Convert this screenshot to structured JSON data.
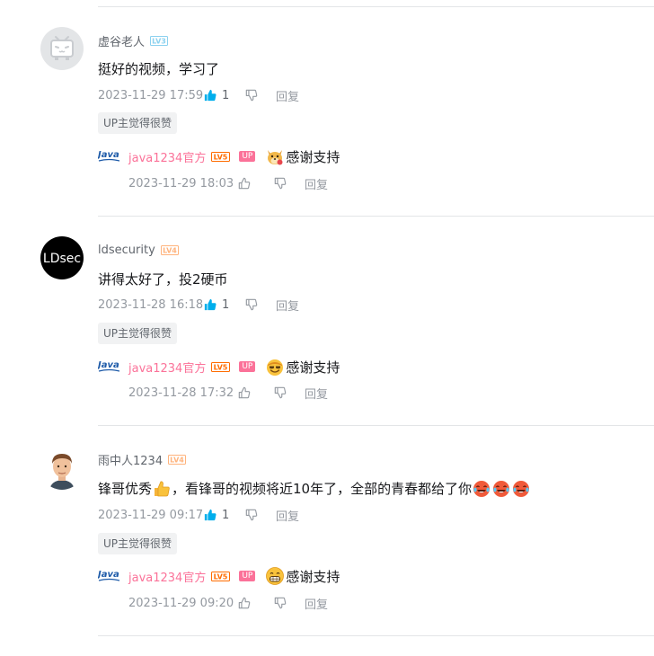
{
  "colors": {
    "accent": "#00aeec",
    "up_pink": "#fb7299",
    "level_blue": "#8bd1ef",
    "level_orange": "#ffb37c",
    "level_red": "#ff6c00"
  },
  "comments": [
    {
      "username": "虚谷老人",
      "level": "LV3",
      "avatar_icon": "bilibili-tv-avatar-icon",
      "content": "挺好的视频，学习了",
      "time": "2023-11-29 17:59",
      "likes": "1",
      "reply_label": "回复",
      "up_liked_label": "UP主觉得很赞",
      "reply": {
        "username": "java1234官方",
        "level": "LV5",
        "up_badge": "UP",
        "emoji_icon": "dog-doge-emoji-icon",
        "text": "感谢支持",
        "time": "2023-11-29 18:03",
        "reply_label": "回复"
      }
    },
    {
      "username": "ldsecurity",
      "level": "LV4",
      "avatar_icon": "ldsec-avatar-icon",
      "avatar_text": "LDsec",
      "content": "讲得太好了，投2硬币",
      "time": "2023-11-28 16:18",
      "likes": "1",
      "reply_label": "回复",
      "up_liked_label": "UP主觉得很赞",
      "reply": {
        "username": "java1234官方",
        "level": "LV5",
        "up_badge": "UP",
        "emoji_icon": "sunglasses-smile-emoji-icon",
        "text": "感谢支持",
        "time": "2023-11-28 17:32",
        "reply_label": "回复"
      }
    },
    {
      "username": "雨中人1234",
      "level": "LV4",
      "avatar_icon": "man-portrait-avatar-icon",
      "content_before": "锋哥优秀",
      "content_emoji": "thumbs-up-emoji-icon",
      "content_after": "，看锋哥的视频将近10年了，全部的青春都给了你",
      "trailing_emojis": [
        "crying-laugh-emoji-icon",
        "crying-laugh-emoji-icon",
        "crying-laugh-emoji-icon"
      ],
      "time": "2023-11-29 09:17",
      "likes": "1",
      "reply_label": "回复",
      "up_liked_label": "UP主觉得很赞",
      "reply": {
        "username": "java1234官方",
        "level": "LV5",
        "up_badge": "UP",
        "emoji_icon": "grin-emoji-icon",
        "text": "感谢支持",
        "time": "2023-11-29 09:20",
        "reply_label": "回复"
      }
    }
  ]
}
